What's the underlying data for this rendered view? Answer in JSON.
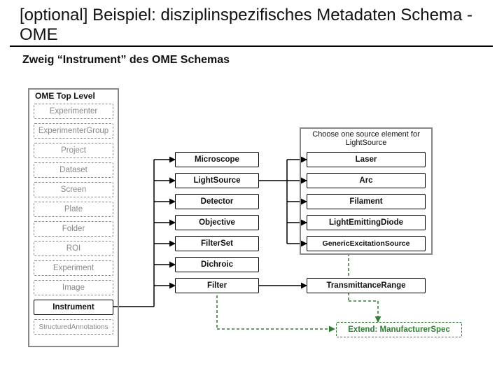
{
  "title": "[optional] Beispiel: disziplinspezifisches Metadaten Schema - OME",
  "subtitle": "Zweig “Instrument” des OME Schemas",
  "groups": {
    "left_label": "OME Top Level",
    "right_label": "Choose one source element for LightSource"
  },
  "left": [
    {
      "label": "Experimenter",
      "style": "dashed"
    },
    {
      "label": "ExperimenterGroup",
      "style": "dashed"
    },
    {
      "label": "Project",
      "style": "dashed"
    },
    {
      "label": "Dataset",
      "style": "dashed"
    },
    {
      "label": "Screen",
      "style": "dashed"
    },
    {
      "label": "Plate",
      "style": "dashed"
    },
    {
      "label": "Folder",
      "style": "dashed"
    },
    {
      "label": "ROI",
      "style": "dashed"
    },
    {
      "label": "Experiment",
      "style": "dashed"
    },
    {
      "label": "Image",
      "style": "dashed"
    },
    {
      "label": "Instrument",
      "style": "solid"
    },
    {
      "label": "StructuredAnnotations",
      "style": "dashed"
    }
  ],
  "mid": [
    {
      "label": "Microscope",
      "style": "solid"
    },
    {
      "label": "LightSource",
      "style": "solid"
    },
    {
      "label": "Detector",
      "style": "solid"
    },
    {
      "label": "Objective",
      "style": "solid"
    },
    {
      "label": "FilterSet",
      "style": "solid"
    },
    {
      "label": "Dichroic",
      "style": "solid"
    },
    {
      "label": "Filter",
      "style": "solid"
    }
  ],
  "right": [
    {
      "label": "Laser",
      "style": "solid"
    },
    {
      "label": "Arc",
      "style": "solid"
    },
    {
      "label": "Filament",
      "style": "solid"
    },
    {
      "label": "LightEmittingDiode",
      "style": "solid"
    },
    {
      "label": "GenericExcitationSource",
      "style": "solid"
    }
  ],
  "extras": {
    "transmittance": {
      "label": "TransmittanceRange",
      "style": "solid"
    },
    "manufacturer": {
      "label": "Extend: ManufacturerSpec",
      "style": "green-dashed"
    }
  }
}
